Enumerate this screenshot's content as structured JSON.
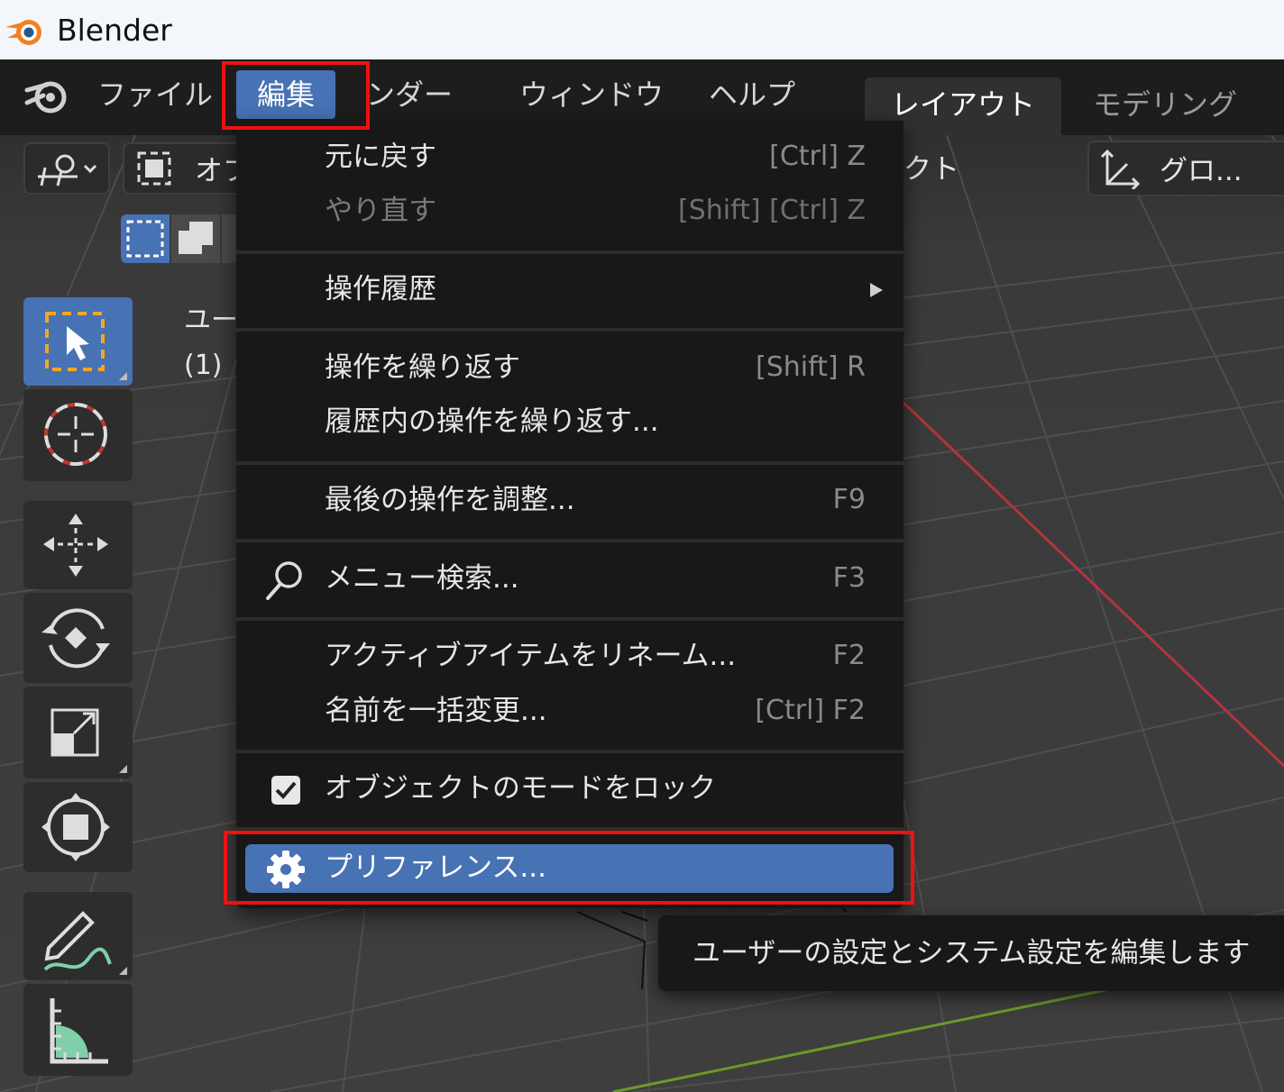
{
  "window": {
    "title": "Blender"
  },
  "menubar": {
    "items": [
      {
        "id": "file",
        "label": "ファイル"
      },
      {
        "id": "edit",
        "label": "編集"
      },
      {
        "id": "render",
        "label": "レンダー",
        "visible_label": "ンダー"
      },
      {
        "id": "window",
        "label": "ウィンドウ"
      },
      {
        "id": "help",
        "label": "ヘルプ"
      }
    ]
  },
  "workspaces": {
    "active": "レイアウト",
    "next": "モデリング"
  },
  "viewport_header": {
    "mode_label": "オブ",
    "select_label": "クト",
    "transform_orientation": "グロ..."
  },
  "viewport_overlay": {
    "line1": "ユー",
    "line2": "(1)"
  },
  "edit_menu": {
    "items": [
      {
        "label": "元に戻す",
        "shortcut": "[Ctrl] Z",
        "enabled": true
      },
      {
        "label": "やり直す",
        "shortcut": "[Shift] [Ctrl] Z",
        "enabled": false
      },
      {
        "label": "操作履歴",
        "submenu": true
      },
      {
        "label": "操作を繰り返す",
        "shortcut": "[Shift] R"
      },
      {
        "label": "履歴内の操作を繰り返す..."
      },
      {
        "label": "最後の操作を調整...",
        "shortcut": "F9"
      },
      {
        "label": "メニュー検索...",
        "shortcut": "F3",
        "icon": "search-icon"
      },
      {
        "label": "アクティブアイテムをリネーム...",
        "shortcut": "F2"
      },
      {
        "label": "名前を一括変更...",
        "shortcut": "[Ctrl] F2"
      },
      {
        "label": "オブジェクトのモードをロック",
        "checked": true
      },
      {
        "label": "プリファレンス...",
        "icon": "gear-icon",
        "highlighted": true
      }
    ]
  },
  "tooltip": {
    "text": "ユーザーの設定とシステム設定を編集します"
  },
  "colors": {
    "accent": "#4772b3",
    "highlight_box": "#ee1111",
    "menu_bg": "#181818",
    "topbar_bg": "#1d1d1d",
    "x_axis": "#b3343f",
    "y_axis": "#6b9a28"
  }
}
